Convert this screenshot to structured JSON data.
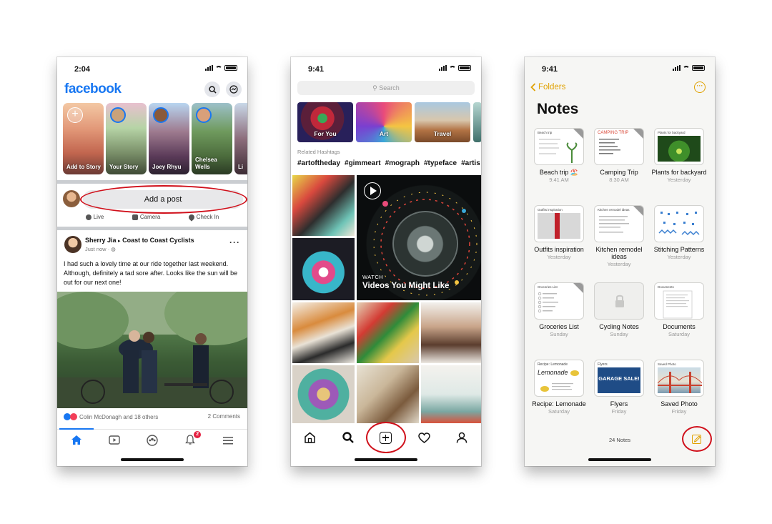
{
  "colors": {
    "fb_blue": "#1877f2",
    "highlight_ring": "#d0101b",
    "notes_accent": "#e0a100",
    "badge_red": "#e41e3f"
  },
  "facebook": {
    "time": "2:04",
    "logo": "facebook",
    "stories": [
      {
        "label": "Add to Story"
      },
      {
        "label": "Your Story"
      },
      {
        "label": "Joey Rhyu"
      },
      {
        "label": "Chelsea Wells"
      },
      {
        "label": "Li"
      }
    ],
    "composer_placeholder": "Add a post",
    "composer_actions": [
      "Live",
      "Camera",
      "Check In"
    ],
    "post": {
      "author": "Sherry Jia",
      "group": "Coast to Coast Cyclists",
      "time": "Just now",
      "text": "I had such a lovely time at our ride together last weekend. Although, definitely a tad sore after. Looks like the sun will be out for our next one!",
      "reactions": "Colin McDonagh and 18 others",
      "comments": "2 Comments"
    },
    "notification_count": "2"
  },
  "instagram": {
    "time": "9:41",
    "search_placeholder": "Search",
    "categories": [
      "For You",
      "Art",
      "Travel"
    ],
    "related_label": "Related Hashtags",
    "hashtags": [
      "#artoftheday",
      "#gimmeart",
      "#mograph",
      "#typeface",
      "#artis"
    ],
    "video": {
      "kicker": "WATCH",
      "title": "Videos You Might Like"
    }
  },
  "notes": {
    "time": "9:41",
    "back_label": "Folders",
    "title": "Notes",
    "items": [
      {
        "name": "Beach trip 🏖️",
        "date": "9:41 AM",
        "thumb_title": "Beach trip"
      },
      {
        "name": "Camping Trip",
        "date": "8:30 AM",
        "thumb_title": "CAMPING TRIP"
      },
      {
        "name": "Plants for backyard",
        "date": "Yesterday",
        "thumb_title": "Plants for backyard"
      },
      {
        "name": "Outfits inspiration",
        "date": "Yesterday",
        "thumb_title": "Outfits inspiration"
      },
      {
        "name": "Kitchen remodel ideas",
        "date": "Yesterday",
        "thumb_title": "Kitchen remodel ideas"
      },
      {
        "name": "Stitching Patterns",
        "date": "Yesterday",
        "thumb_title": ""
      },
      {
        "name": "Groceries List",
        "date": "Sunday",
        "thumb_title": "Groceries List"
      },
      {
        "name": "Cycling Notes",
        "date": "Sunday",
        "thumb_title": ""
      },
      {
        "name": "Documents",
        "date": "Saturday",
        "thumb_title": "Documents"
      },
      {
        "name": "Recipe: Lemonade",
        "date": "Saturday",
        "thumb_title": "Lemonade"
      },
      {
        "name": "Flyers",
        "date": "Friday",
        "thumb_title": "GARAGE SALE!"
      },
      {
        "name": "Saved Photo",
        "date": "Friday",
        "thumb_title": "Saved Photo"
      }
    ],
    "count_label": "24 Notes"
  }
}
